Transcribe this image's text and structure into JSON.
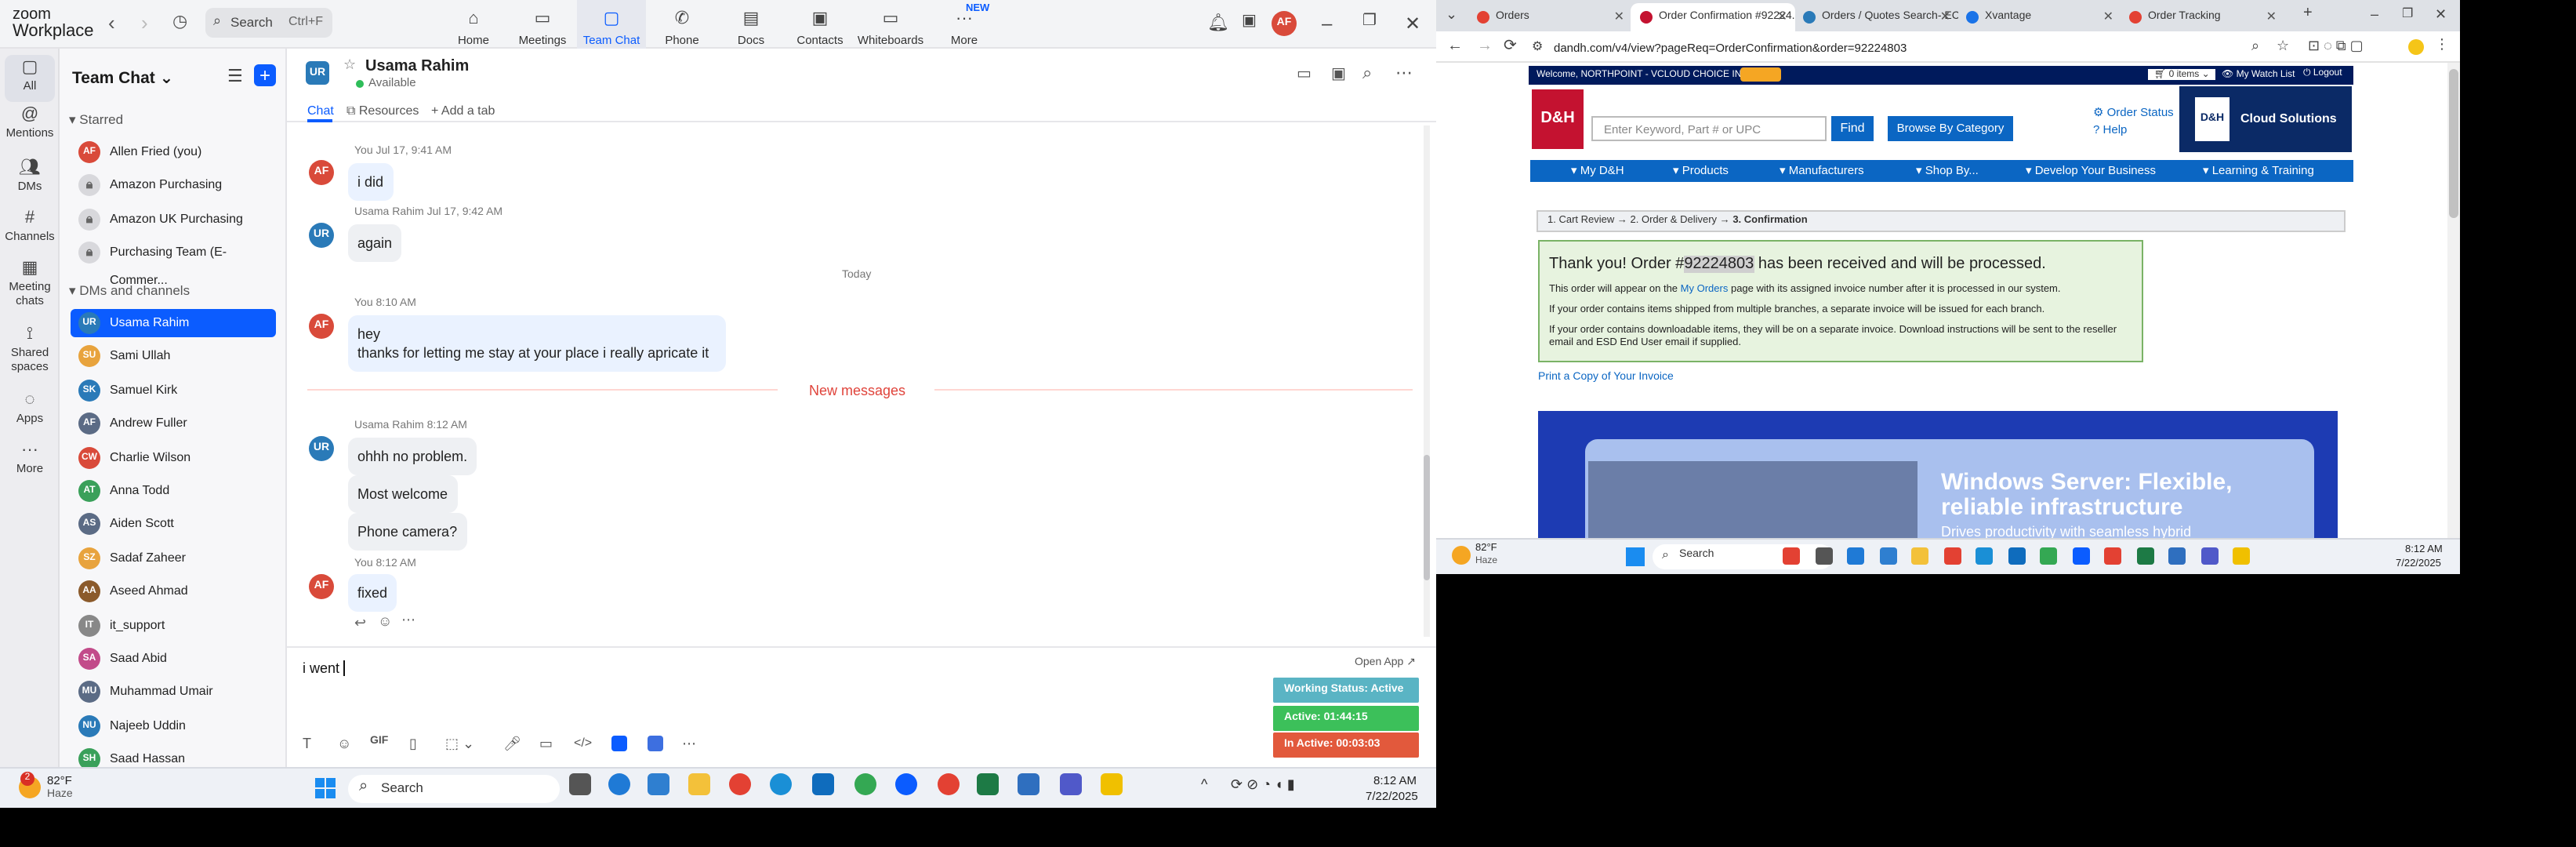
{
  "zoom": {
    "logo_line1": "zoom",
    "logo_line2": "Workplace",
    "search": {
      "placeholder": "Search",
      "shortcut": "Ctrl+F"
    },
    "nav": [
      "Home",
      "Meetings",
      "Team Chat",
      "Phone",
      "Docs",
      "Contacts",
      "Whiteboards",
      "More"
    ],
    "new_badge": "NEW",
    "user_initials": "AF",
    "rail": [
      "All",
      "Mentions",
      "DMs",
      "Channels",
      "Meeting chats",
      "Shared spaces",
      "Apps",
      "More"
    ],
    "list_title": "Team Chat",
    "starred_label": "Starred",
    "starred": [
      "Allen Fried (you)",
      "Amazon Purchasing",
      "Amazon UK Purchasing",
      "Purchasing Team (E-Commer..."
    ],
    "dms_label": "DMs and channels",
    "dms": [
      {
        "initials": "UR",
        "name": "Usama Rahim",
        "color": "#2a7ab8"
      },
      {
        "initials": "SU",
        "name": "Sami Ullah",
        "color": "#e8a33d"
      },
      {
        "initials": "SK",
        "name": "Samuel Kirk",
        "color": "#2a7ab8"
      },
      {
        "initials": "AF",
        "name": "Andrew Fuller",
        "color": "#5b6b85"
      },
      {
        "initials": "CW",
        "name": "Charlie Wilson",
        "color": "#d94a3a"
      },
      {
        "initials": "AT",
        "name": "Anna Todd",
        "color": "#3aa05a"
      },
      {
        "initials": "AS",
        "name": "Aiden Scott",
        "color": "#5b6b85"
      },
      {
        "initials": "SZ",
        "name": "Sadaf Zaheer",
        "color": "#e8a33d"
      },
      {
        "initials": "AA",
        "name": "Aseed Ahmad",
        "color": "#8b5a2b"
      },
      {
        "initials": "IT",
        "name": "it_support",
        "color": "#888888"
      },
      {
        "initials": "SA",
        "name": "Saad Abid",
        "color": "#c24b8a"
      },
      {
        "initials": "MU",
        "name": "Muhammad Umair",
        "color": "#5b6b85"
      },
      {
        "initials": "NU",
        "name": "Najeeb Uddin",
        "color": "#2a7ab8"
      },
      {
        "initials": "SH",
        "name": "Saad Hassan",
        "color": "#3aa05a"
      }
    ],
    "chat": {
      "contact": "Usama Rahim",
      "contact_initials": "UR",
      "presence": "Available",
      "tabs": [
        "Chat",
        "Resources",
        "Add a tab"
      ],
      "day_divider": "Today",
      "new_messages": "New messages",
      "messages": [
        {
          "meta": "You Jul 17, 9:41 AM",
          "text": "i did"
        },
        {
          "meta": "Usama Rahim Jul 17, 9:42 AM",
          "text": "again"
        },
        {
          "meta": "You 8:10 AM",
          "text1": "hey",
          "text2": "thanks for letting me stay at your place i really apricate it"
        },
        {
          "meta": "Usama Rahim 8:12 AM",
          "text": "ohhh no problem."
        },
        {
          "text": "Most welcome"
        },
        {
          "text": "Phone camera?"
        },
        {
          "meta": "You 8:12 AM",
          "text": "fixed"
        }
      ],
      "compose_text": "i went"
    },
    "status_widget": {
      "open_app": "Open App",
      "working": "Working Status: Active",
      "active": "Active: 01:44:15",
      "inactive": "In Active: 00:03:03"
    }
  },
  "taskbar": {
    "weather_temp": "82°F",
    "weather_desc": "Haze",
    "search": "Search",
    "time": "8:12 AM",
    "date": "7/22/2025",
    "badge": "2"
  },
  "browser": {
    "tabs": [
      {
        "title": "Orders",
        "color": "#e34133"
      },
      {
        "title": "Order Confirmation #92224...",
        "color": "#c41230"
      },
      {
        "title": "Orders / Quotes Search- ECI",
        "color": "#2a7ab8"
      },
      {
        "title": "Xvantage",
        "color": "#1a73e8"
      },
      {
        "title": "Order Tracking",
        "color": "#e34133"
      }
    ],
    "url": "dandh.com/v4/view?pageReq=OrderConfirmation&order=92224803",
    "welcome": "Welcome, NORTHPOINT - VCLOUD CHOICE INC",
    "cart": "0 items",
    "watch_list": "My Watch List",
    "logout": "Logout",
    "logo_text": "D&H",
    "search_placeholder": "Enter Keyword, Part # or UPC",
    "find": "Find",
    "browse": "Browse By Category",
    "order_status": "Order Status",
    "help": "Help",
    "cloud": "Cloud Solutions",
    "nav": [
      "My D&H",
      "Products",
      "Manufacturers",
      "Shop By...",
      "Develop Your Business",
      "Learning & Training"
    ],
    "steps": [
      "1. Cart Review",
      "2. Order & Delivery",
      "3. Confirmation"
    ],
    "thanks_pre": "Thank you! Order #",
    "order_no": "92224803",
    "thanks_post": "has been received and will be processed.",
    "line1_pre": "This order will appear on the",
    "line1_link": "My Orders",
    "line1_post": "page with its assigned invoice number after it is processed in our system.",
    "line2": "If your order contains items shipped from multiple branches, a separate invoice will be issued for each branch.",
    "line3": "If your order contains downloadable items, they will be on a separate invoice. Download instructions will be sent to the reseller email and ESD End User email if supplied.",
    "print": "Print a Copy of Your Invoice",
    "banner_title": "Windows Server: Flexible, reliable infrastructure",
    "banner_sub": "Drives productivity with seamless hybrid"
  }
}
